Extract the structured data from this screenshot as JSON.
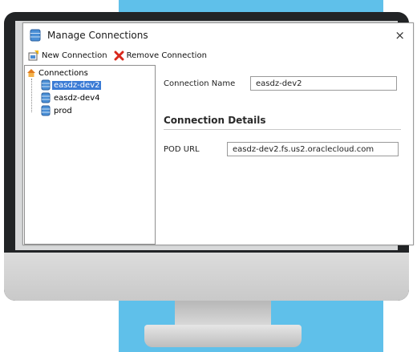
{
  "window": {
    "title": "Manage Connections",
    "close_glyph": "×"
  },
  "toolbar": {
    "new_label": "New Connection",
    "remove_label": "Remove Connection"
  },
  "tree": {
    "root": "Connections",
    "items": [
      {
        "label": "easdz-dev2",
        "selected": true
      },
      {
        "label": "easdz-dev4",
        "selected": false
      },
      {
        "label": "prod",
        "selected": false
      }
    ]
  },
  "details": {
    "connection_name_label": "Connection Name",
    "connection_name_value": "easdz-dev2",
    "section_title": "Connection Details",
    "pod_url_label": "POD URL",
    "pod_url_value": "easdz-dev2.fs.us2.oraclecloud.com"
  },
  "colors": {
    "accent": "#5fc0ea",
    "selection": "#3a7bd5"
  }
}
